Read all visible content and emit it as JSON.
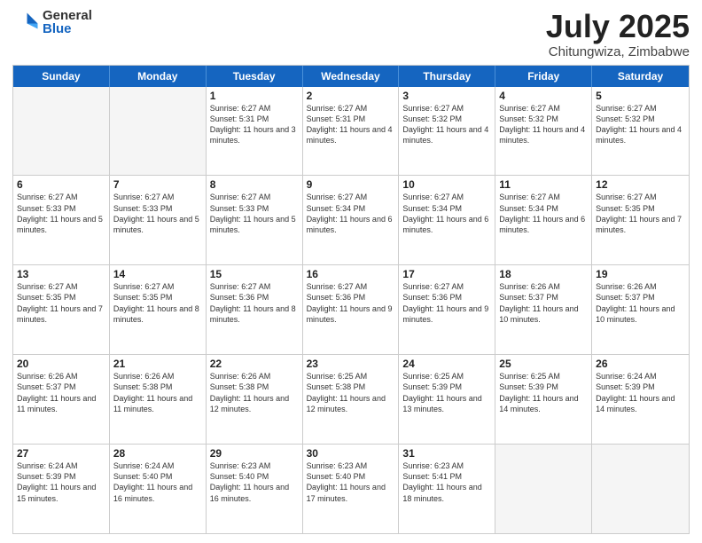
{
  "logo": {
    "general": "General",
    "blue": "Blue"
  },
  "title": "July 2025",
  "subtitle": "Chitungwiza, Zimbabwe",
  "header_days": [
    "Sunday",
    "Monday",
    "Tuesday",
    "Wednesday",
    "Thursday",
    "Friday",
    "Saturday"
  ],
  "rows": [
    [
      {
        "day": "",
        "empty": true
      },
      {
        "day": "",
        "empty": true
      },
      {
        "day": "1",
        "info": "Sunrise: 6:27 AM\nSunset: 5:31 PM\nDaylight: 11 hours and 3 minutes."
      },
      {
        "day": "2",
        "info": "Sunrise: 6:27 AM\nSunset: 5:31 PM\nDaylight: 11 hours and 4 minutes."
      },
      {
        "day": "3",
        "info": "Sunrise: 6:27 AM\nSunset: 5:32 PM\nDaylight: 11 hours and 4 minutes."
      },
      {
        "day": "4",
        "info": "Sunrise: 6:27 AM\nSunset: 5:32 PM\nDaylight: 11 hours and 4 minutes."
      },
      {
        "day": "5",
        "info": "Sunrise: 6:27 AM\nSunset: 5:32 PM\nDaylight: 11 hours and 4 minutes."
      }
    ],
    [
      {
        "day": "6",
        "info": "Sunrise: 6:27 AM\nSunset: 5:33 PM\nDaylight: 11 hours and 5 minutes."
      },
      {
        "day": "7",
        "info": "Sunrise: 6:27 AM\nSunset: 5:33 PM\nDaylight: 11 hours and 5 minutes."
      },
      {
        "day": "8",
        "info": "Sunrise: 6:27 AM\nSunset: 5:33 PM\nDaylight: 11 hours and 5 minutes."
      },
      {
        "day": "9",
        "info": "Sunrise: 6:27 AM\nSunset: 5:34 PM\nDaylight: 11 hours and 6 minutes."
      },
      {
        "day": "10",
        "info": "Sunrise: 6:27 AM\nSunset: 5:34 PM\nDaylight: 11 hours and 6 minutes."
      },
      {
        "day": "11",
        "info": "Sunrise: 6:27 AM\nSunset: 5:34 PM\nDaylight: 11 hours and 6 minutes."
      },
      {
        "day": "12",
        "info": "Sunrise: 6:27 AM\nSunset: 5:35 PM\nDaylight: 11 hours and 7 minutes."
      }
    ],
    [
      {
        "day": "13",
        "info": "Sunrise: 6:27 AM\nSunset: 5:35 PM\nDaylight: 11 hours and 7 minutes."
      },
      {
        "day": "14",
        "info": "Sunrise: 6:27 AM\nSunset: 5:35 PM\nDaylight: 11 hours and 8 minutes."
      },
      {
        "day": "15",
        "info": "Sunrise: 6:27 AM\nSunset: 5:36 PM\nDaylight: 11 hours and 8 minutes."
      },
      {
        "day": "16",
        "info": "Sunrise: 6:27 AM\nSunset: 5:36 PM\nDaylight: 11 hours and 9 minutes."
      },
      {
        "day": "17",
        "info": "Sunrise: 6:27 AM\nSunset: 5:36 PM\nDaylight: 11 hours and 9 minutes."
      },
      {
        "day": "18",
        "info": "Sunrise: 6:26 AM\nSunset: 5:37 PM\nDaylight: 11 hours and 10 minutes."
      },
      {
        "day": "19",
        "info": "Sunrise: 6:26 AM\nSunset: 5:37 PM\nDaylight: 11 hours and 10 minutes."
      }
    ],
    [
      {
        "day": "20",
        "info": "Sunrise: 6:26 AM\nSunset: 5:37 PM\nDaylight: 11 hours and 11 minutes."
      },
      {
        "day": "21",
        "info": "Sunrise: 6:26 AM\nSunset: 5:38 PM\nDaylight: 11 hours and 11 minutes."
      },
      {
        "day": "22",
        "info": "Sunrise: 6:26 AM\nSunset: 5:38 PM\nDaylight: 11 hours and 12 minutes."
      },
      {
        "day": "23",
        "info": "Sunrise: 6:25 AM\nSunset: 5:38 PM\nDaylight: 11 hours and 12 minutes."
      },
      {
        "day": "24",
        "info": "Sunrise: 6:25 AM\nSunset: 5:39 PM\nDaylight: 11 hours and 13 minutes."
      },
      {
        "day": "25",
        "info": "Sunrise: 6:25 AM\nSunset: 5:39 PM\nDaylight: 11 hours and 14 minutes."
      },
      {
        "day": "26",
        "info": "Sunrise: 6:24 AM\nSunset: 5:39 PM\nDaylight: 11 hours and 14 minutes."
      }
    ],
    [
      {
        "day": "27",
        "info": "Sunrise: 6:24 AM\nSunset: 5:39 PM\nDaylight: 11 hours and 15 minutes."
      },
      {
        "day": "28",
        "info": "Sunrise: 6:24 AM\nSunset: 5:40 PM\nDaylight: 11 hours and 16 minutes."
      },
      {
        "day": "29",
        "info": "Sunrise: 6:23 AM\nSunset: 5:40 PM\nDaylight: 11 hours and 16 minutes."
      },
      {
        "day": "30",
        "info": "Sunrise: 6:23 AM\nSunset: 5:40 PM\nDaylight: 11 hours and 17 minutes."
      },
      {
        "day": "31",
        "info": "Sunrise: 6:23 AM\nSunset: 5:41 PM\nDaylight: 11 hours and 18 minutes."
      },
      {
        "day": "",
        "empty": true
      },
      {
        "day": "",
        "empty": true
      }
    ]
  ]
}
